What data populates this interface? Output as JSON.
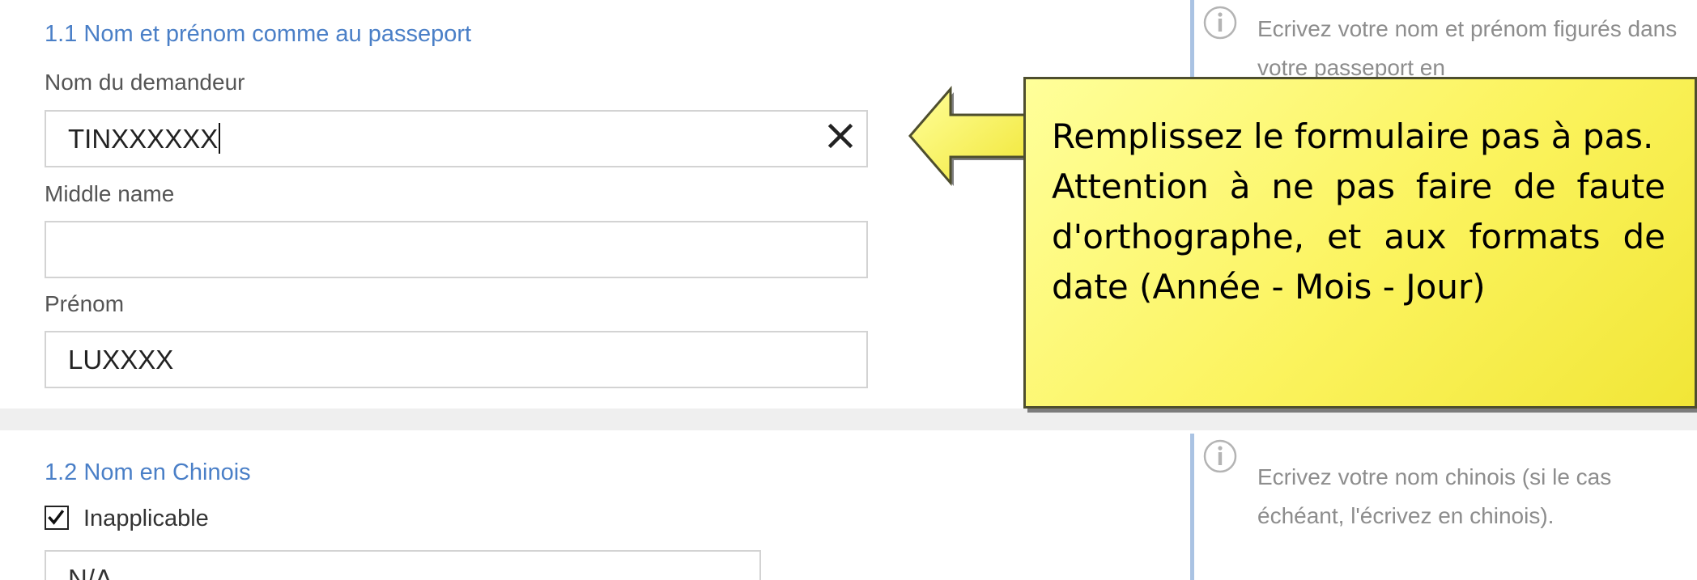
{
  "section1": {
    "title": "1.1 Nom et prénom comme au passeport",
    "surname_label": "Nom du demandeur",
    "surname_value": "TINXXXXXX",
    "middle_label": "Middle name",
    "middle_value": "",
    "given_label": "Prénom",
    "given_value": "LUXXXX",
    "help_text": "Ecrivez votre nom et prénom figurés dans votre passeport en"
  },
  "section2": {
    "title": "1.2 Nom en Chinois",
    "checkbox_label": "Inapplicable",
    "checkbox_checked": true,
    "value": "N/A",
    "help_text": "Ecrivez votre nom chinois (si le cas échéant, l'écrivez en chinois)."
  },
  "callout": {
    "line1": "Remplissez le formulaire pas à pas.",
    "line2": "Attention à ne pas faire de faute d'orthographe, et aux formats de date (Année - Mois - Jour)"
  },
  "colors": {
    "accent": "#4a7fc7",
    "help_border": "#aac3e3",
    "callout_fill": "#fbf35d"
  },
  "icons": {
    "clear": "close-icon",
    "info": "info-icon",
    "check": "checkmark-icon"
  }
}
